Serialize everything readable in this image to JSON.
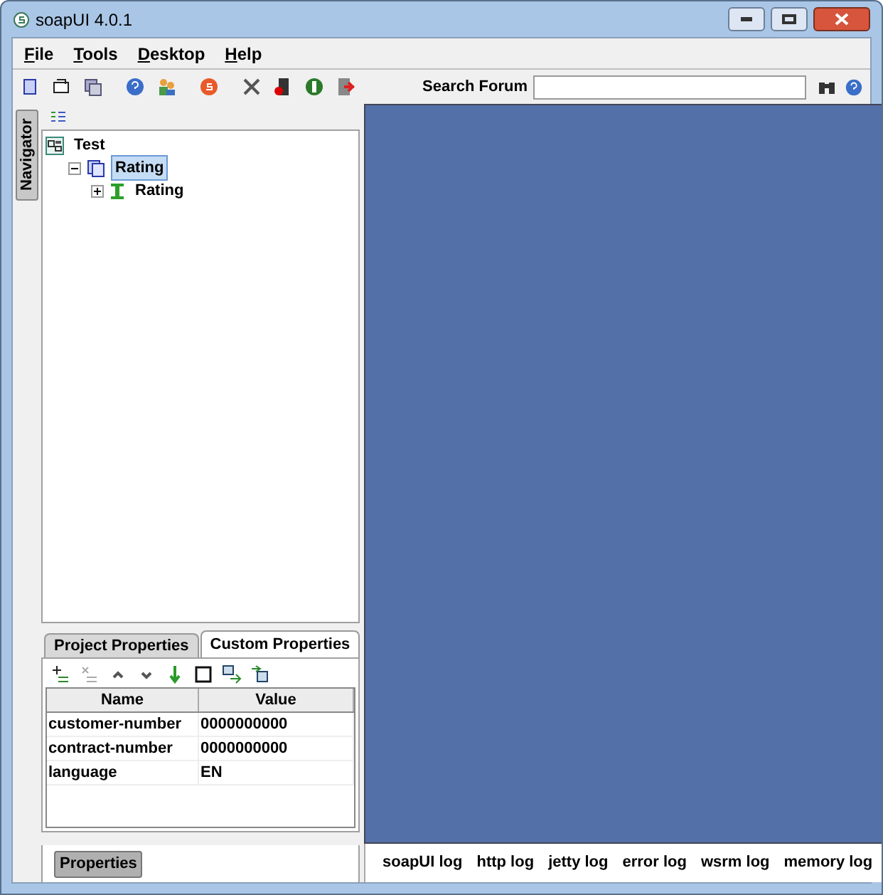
{
  "window": {
    "title": "soapUI 4.0.1"
  },
  "menu": [
    {
      "label": "File"
    },
    {
      "label": "Tools"
    },
    {
      "label": "Desktop"
    },
    {
      "label": "Help"
    }
  ],
  "search": {
    "label": "Search Forum"
  },
  "navigator_tab": "Navigator",
  "tree": [
    {
      "label": "Test",
      "kind": "workspace",
      "selected": false,
      "children": [
        {
          "label": "Rating",
          "kind": "project",
          "selected": true,
          "expanded": true,
          "children": [
            {
              "label": "Rating",
              "kind": "interface",
              "selected": false,
              "expanded": false
            }
          ]
        }
      ]
    }
  ],
  "properties": {
    "tabs": [
      {
        "label": "Project Properties",
        "selected": false
      },
      {
        "label": "Custom Properties",
        "selected": true
      }
    ],
    "columns": [
      "Name",
      "Value"
    ],
    "rows": [
      [
        "customer-number",
        "0000000000"
      ],
      [
        "contract-number",
        "0000000000"
      ],
      [
        "language",
        "EN"
      ]
    ]
  },
  "properties_button": "Properties",
  "log_tabs": [
    {
      "label": "soapUI log"
    },
    {
      "label": "http log"
    },
    {
      "label": "jetty log"
    },
    {
      "label": "error log"
    },
    {
      "label": "wsrm log"
    },
    {
      "label": "memory log"
    }
  ]
}
